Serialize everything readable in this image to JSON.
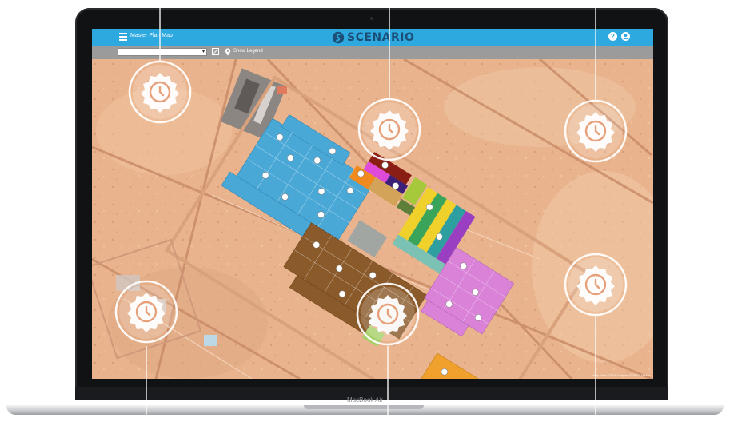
{
  "app": {
    "title": "Master Plan Map",
    "brand": "SCENARIO",
    "brand_color": "#1b4f78",
    "topbar_color": "#2ea9e0",
    "toolbar_color": "#9b9b9b"
  },
  "toolbar": {
    "select_value": "",
    "legend_label": "Show Legend"
  },
  "map": {
    "attribution": "Map data ©2020 Imagery ©2020, Maxar"
  },
  "device": {
    "label": "MacBook Air"
  },
  "icons": {
    "menu": "hamburger-icon",
    "help": "help-icon",
    "user": "user-icon",
    "feature": "clock-gear-icon"
  }
}
